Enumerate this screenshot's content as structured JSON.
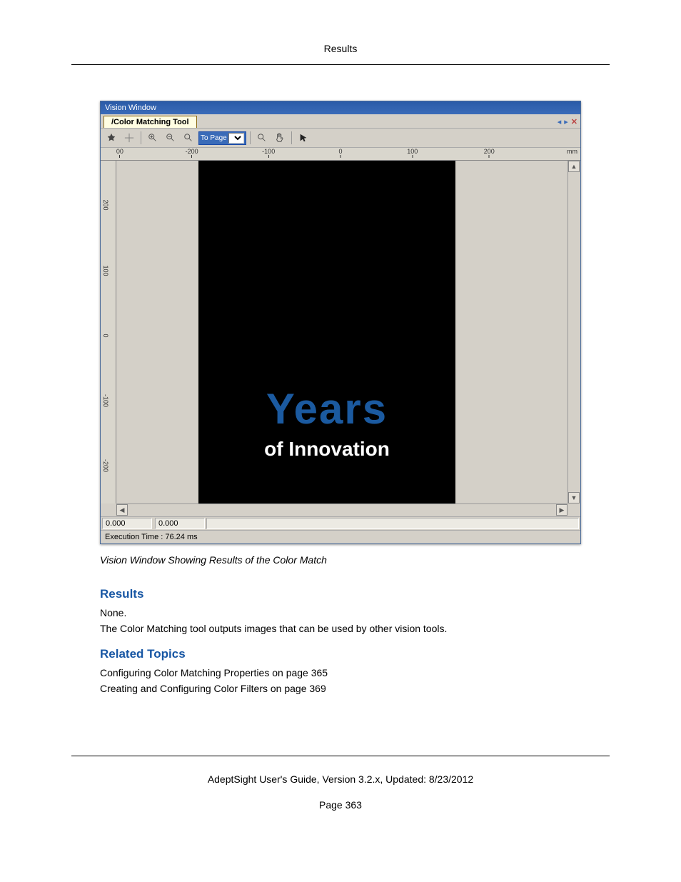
{
  "header": {
    "title": "Results"
  },
  "vision_window": {
    "title": "Vision Window",
    "tab_label": "/Color Matching Tool",
    "toolbar": {
      "to_page_label": "To Page",
      "to_page_select": "▼"
    },
    "ruler_x": {
      "ticks": [
        "00",
        "-200",
        "-100",
        "0",
        "100",
        "200"
      ],
      "unit": "mm"
    },
    "ruler_y": {
      "ticks": [
        "200",
        "100",
        "0",
        "-100",
        "-200"
      ]
    },
    "image": {
      "line1": "Years",
      "line2": "of Innovation"
    },
    "coords": {
      "x": "0.000",
      "y": "0.000"
    },
    "exec_time": "Execution Time : 76.24 ms"
  },
  "caption": "Vision Window Showing Results of the Color Match",
  "results": {
    "heading": "Results",
    "body": "None.",
    "note": "The Color Matching tool outputs images that can be used by other vision tools."
  },
  "related": {
    "heading": "Related Topics",
    "items": [
      "Configuring Color Matching Properties on page 365",
      "Creating and Configuring Color Filters on page 369"
    ]
  },
  "footer": {
    "line": "AdeptSight User's Guide,  Version 3.2.x, Updated: 8/23/2012",
    "page": "Page 363"
  }
}
